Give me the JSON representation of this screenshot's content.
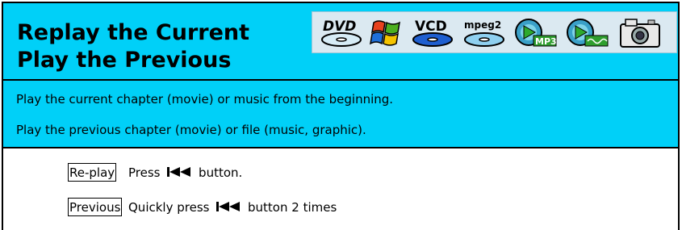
{
  "header": {
    "title_line1": "Replay the Current",
    "title_line2": "Play the Previous",
    "format_icons": [
      "dvd-icon",
      "windows-icon",
      "vcd-icon",
      "mpeg2-icon",
      "mp3-icon",
      "wma-icon",
      "camera-icon"
    ],
    "format_labels": {
      "dvd": "DVD",
      "vcd": "VCD",
      "mpeg2": "mpeg2",
      "mp3": "MP3"
    }
  },
  "description": {
    "line1": "Play the current chapter (movie) or music from the beginning.",
    "line2": "Play the previous chapter (movie) or file (music, graphic)."
  },
  "steps": [
    {
      "tag": "Re-play",
      "before": "Press",
      "after": "button."
    },
    {
      "tag": "Previous",
      "before": "Quickly press",
      "after": "button 2 times"
    }
  ],
  "colors": {
    "header_bg": "#00d0f8",
    "icon_strip_bg": "#dbe9f1"
  }
}
